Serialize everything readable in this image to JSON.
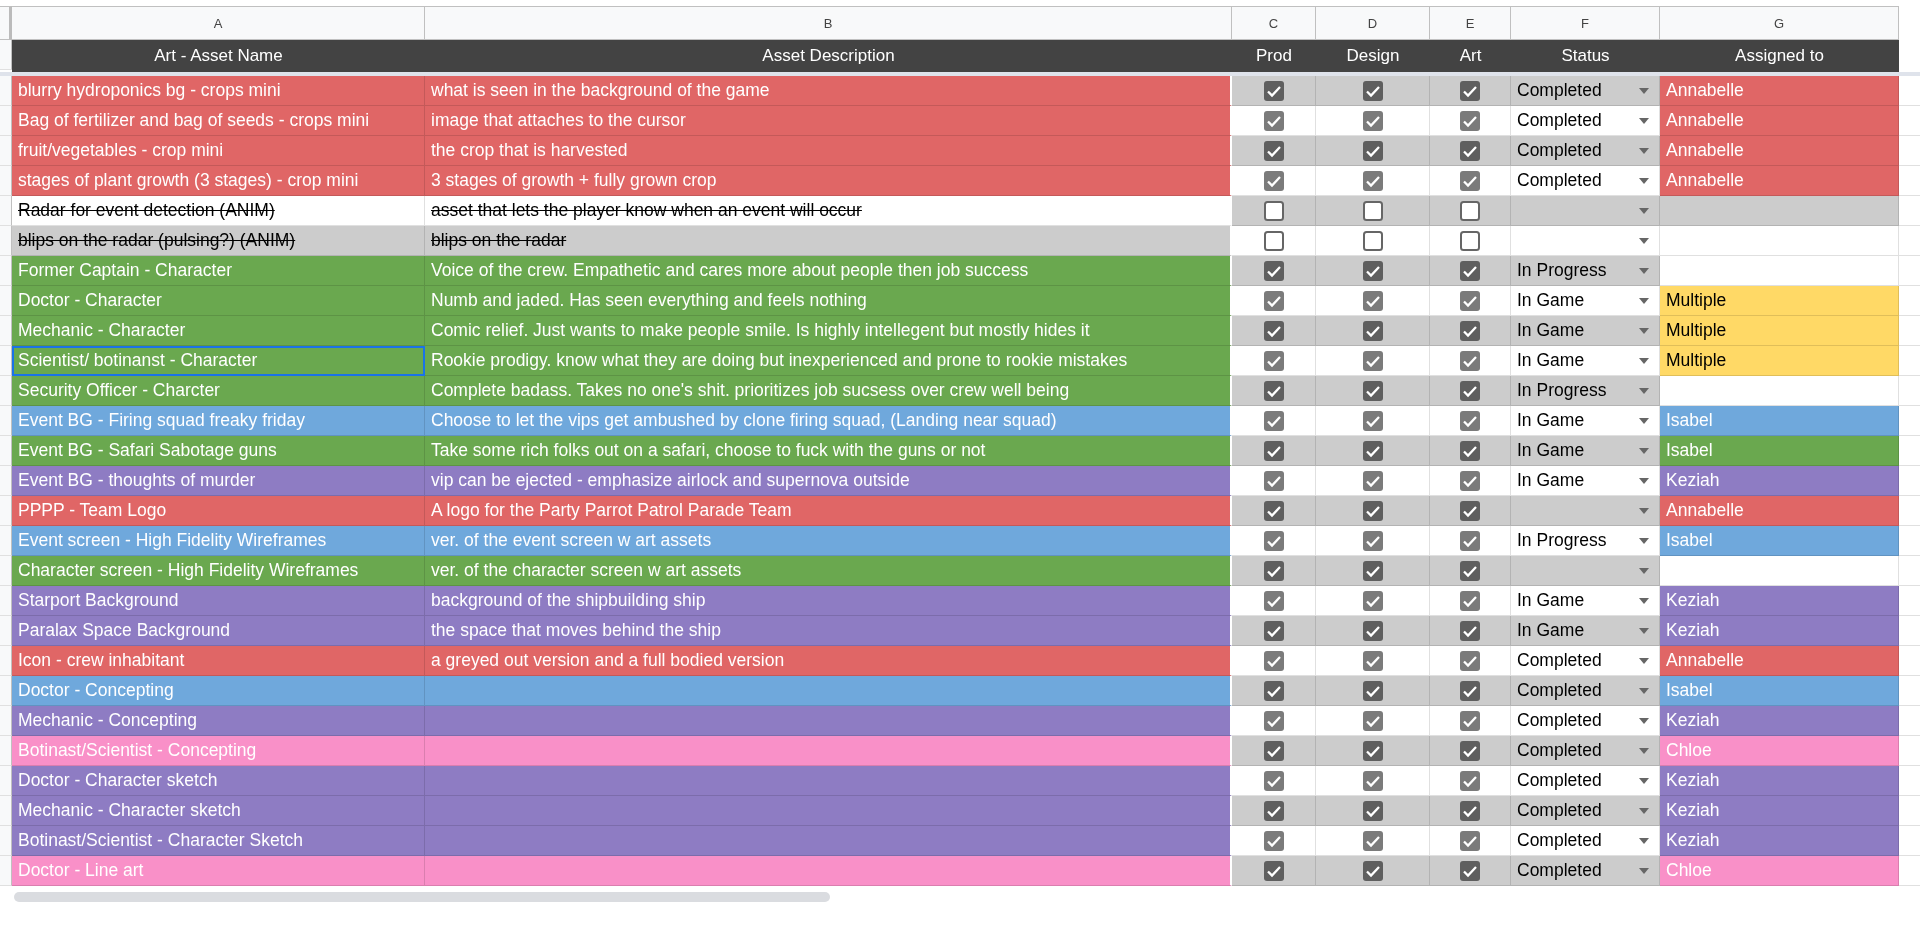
{
  "column_letters": [
    "A",
    "B",
    "C",
    "D",
    "E",
    "F",
    "G"
  ],
  "headers": [
    "Art - Asset Name",
    "Asset Description",
    "Prod",
    "Design",
    "Art",
    "Status",
    "Assigned to"
  ],
  "rows": [
    {
      "name": "blurry hydroponics bg - crops mini",
      "description": "what is seen in the background of the game",
      "color": "#e06666",
      "struck": false,
      "selected": false,
      "prod": true,
      "design": true,
      "art": true,
      "status": "Completed",
      "assignee": {
        "name": "Annabelle",
        "color": "#e06666"
      }
    },
    {
      "name": "Bag of fertilizer and bag of seeds - crops mini",
      "description": "image that attaches to the cursor",
      "color": "#e06666",
      "struck": false,
      "selected": false,
      "prod": true,
      "design": true,
      "art": true,
      "status": "Completed",
      "assignee": {
        "name": "Annabelle",
        "color": "#e06666"
      }
    },
    {
      "name": "fruit/vegetables - crop mini",
      "description": "the crop that is harvested",
      "color": "#e06666",
      "struck": false,
      "selected": false,
      "prod": true,
      "design": true,
      "art": true,
      "status": "Completed",
      "assignee": {
        "name": "Annabelle",
        "color": "#e06666"
      }
    },
    {
      "name": "stages of plant growth (3 stages) - crop mini",
      "description": "3 stages of growth + fully grown crop",
      "color": "#e06666",
      "struck": false,
      "selected": false,
      "prod": true,
      "design": true,
      "art": true,
      "status": "Completed",
      "assignee": {
        "name": "Annabelle",
        "color": "#e06666"
      }
    },
    {
      "name": "Radar for event detection (ANIM)",
      "description": "asset that lets the player know when an event will occur",
      "color": "#ffffff",
      "struck": true,
      "selected": false,
      "prod": false,
      "design": false,
      "art": false
    },
    {
      "name": "blips on the radar (pulsing?) (ANIM)",
      "description": "blips on the radar",
      "color": "#cccccc",
      "struck": true,
      "selected": false,
      "prod": false,
      "design": false,
      "art": false
    },
    {
      "name": "Former Captain - Character",
      "description": "Voice of the crew. Empathetic and cares more about people then job success",
      "color": "#6aa84f",
      "struck": false,
      "selected": false,
      "prod": true,
      "design": true,
      "art": true,
      "status": "In Progress"
    },
    {
      "name": "Doctor - Character",
      "description": "Numb and jaded. Has seen everything and feels nothing",
      "color": "#6aa84f",
      "struck": false,
      "selected": false,
      "prod": true,
      "design": true,
      "art": true,
      "status": "In Game",
      "assignee": {
        "name": "Multiple",
        "color": "#ffd966"
      }
    },
    {
      "name": "Mechanic - Character",
      "description": "Comic relief. Just wants to make people smile. Is highly intellegent but mostly hides it",
      "color": "#6aa84f",
      "struck": false,
      "selected": false,
      "prod": true,
      "design": true,
      "art": true,
      "status": "In Game",
      "assignee": {
        "name": "Multiple",
        "color": "#ffd966"
      }
    },
    {
      "name": "Scientist/ botinanst  - Character",
      "description": "Rookie prodigy. know what they are doing but inexperienced and prone to rookie mistakes",
      "color": "#6aa84f",
      "struck": false,
      "selected": true,
      "prod": true,
      "design": true,
      "art": true,
      "status": "In Game",
      "assignee": {
        "name": "Multiple",
        "color": "#ffd966"
      }
    },
    {
      "name": "Security Officer - Charcter",
      "description": "Complete badass. Takes no one's shit. prioritizes job sucsess over crew well being",
      "color": "#6aa84f",
      "struck": false,
      "selected": false,
      "prod": true,
      "design": true,
      "art": true,
      "status": "In Progress"
    },
    {
      "name": "Event BG - Firing squad freaky friday",
      "description": "Choose to let the vips get ambushed by clone firing squad, (Landing near squad)",
      "color": "#6fa8dc",
      "struck": false,
      "selected": false,
      "prod": true,
      "design": true,
      "art": true,
      "status": "In Game",
      "assignee": {
        "name": "Isabel",
        "color": "#6fa8dc"
      }
    },
    {
      "name": "Event BG - Safari Sabotage guns",
      "description": "Take some rich folks out on a safari, choose to fuck with the guns or not",
      "color": "#6aa84f",
      "struck": false,
      "selected": false,
      "prod": true,
      "design": true,
      "art": true,
      "status": "In Game",
      "assignee": {
        "name": "Isabel",
        "color": "#6aa84f"
      }
    },
    {
      "name": "Event BG - thoughts of murder",
      "description": "vip can be ejected -  emphasize airlock and supernova outside",
      "color": "#8e7cc3",
      "struck": false,
      "selected": false,
      "prod": true,
      "design": true,
      "art": true,
      "status": "In Game",
      "assignee": {
        "name": "Keziah",
        "color": "#8e7cc3"
      }
    },
    {
      "name": "PPPP - Team Logo",
      "description": "A logo for the Party Parrot Patrol Parade Team",
      "color": "#e06666",
      "struck": false,
      "selected": false,
      "prod": true,
      "design": true,
      "art": true,
      "assignee": {
        "name": "Annabelle",
        "color": "#e06666"
      }
    },
    {
      "name": "Event screen - High Fidelity Wireframes",
      "description": "ver. of the event screen w art assets",
      "color": "#6fa8dc",
      "struck": false,
      "selected": false,
      "prod": true,
      "design": true,
      "art": true,
      "status": "In Progress",
      "assignee": {
        "name": "Isabel",
        "color": "#6fa8dc"
      }
    },
    {
      "name": "Character screen - High Fidelity Wireframes",
      "description": "ver. of the character screen w art assets",
      "color": "#6aa84f",
      "struck": false,
      "selected": false,
      "prod": true,
      "design": true,
      "art": true
    },
    {
      "name": "Starport Background",
      "description": "background of the shipbuilding ship",
      "color": "#8e7cc3",
      "struck": false,
      "selected": false,
      "prod": true,
      "design": true,
      "art": true,
      "status": "In Game",
      "assignee": {
        "name": "Keziah",
        "color": "#8e7cc3"
      }
    },
    {
      "name": "Paralax Space Background",
      "description": "the space that moves behind the ship",
      "color": "#8e7cc3",
      "struck": false,
      "selected": false,
      "prod": true,
      "design": true,
      "art": true,
      "status": "In Game",
      "assignee": {
        "name": "Keziah",
        "color": "#8e7cc3"
      }
    },
    {
      "name": "Icon - crew inhabitant",
      "description": "a greyed out version and a full bodied version",
      "color": "#e06666",
      "struck": false,
      "selected": false,
      "prod": true,
      "design": true,
      "art": true,
      "status": "Completed",
      "assignee": {
        "name": "Annabelle",
        "color": "#e06666"
      }
    },
    {
      "name": "Doctor - Concepting",
      "color": "#6fa8dc",
      "struck": false,
      "selected": false,
      "prod": true,
      "design": true,
      "art": true,
      "status": "Completed",
      "assignee": {
        "name": "Isabel",
        "color": "#6fa8dc"
      }
    },
    {
      "name": "Mechanic - Concepting",
      "color": "#8e7cc3",
      "struck": false,
      "selected": false,
      "prod": true,
      "design": true,
      "art": true,
      "status": "Completed",
      "assignee": {
        "name": "Keziah",
        "color": "#8e7cc3"
      }
    },
    {
      "name": "Botinast/Scientist - Concepting",
      "color": "#f990c8",
      "struck": false,
      "selected": false,
      "prod": true,
      "design": true,
      "art": true,
      "status": "Completed",
      "assignee": {
        "name": "Chloe",
        "color": "#f990c8"
      }
    },
    {
      "name": "Doctor - Character sketch",
      "color": "#8e7cc3",
      "struck": false,
      "selected": false,
      "prod": true,
      "design": true,
      "art": true,
      "status": "Completed",
      "assignee": {
        "name": "Keziah",
        "color": "#8e7cc3"
      }
    },
    {
      "name": "Mechanic - Character sketch",
      "color": "#8e7cc3",
      "struck": false,
      "selected": false,
      "prod": true,
      "design": true,
      "art": true,
      "status": "Completed",
      "assignee": {
        "name": "Keziah",
        "color": "#8e7cc3"
      }
    },
    {
      "name": "Botinast/Scientist - Character Sketch",
      "color": "#8e7cc3",
      "struck": false,
      "selected": false,
      "prod": true,
      "design": true,
      "art": true,
      "status": "Completed",
      "assignee": {
        "name": "Keziah",
        "color": "#8e7cc3"
      }
    },
    {
      "name": "Doctor - Line art",
      "color": "#f990c8",
      "struck": false,
      "selected": false,
      "prod": true,
      "design": true,
      "art": true,
      "status": "Completed",
      "assignee": {
        "name": "Chloe",
        "color": "#f990c8"
      }
    }
  ]
}
